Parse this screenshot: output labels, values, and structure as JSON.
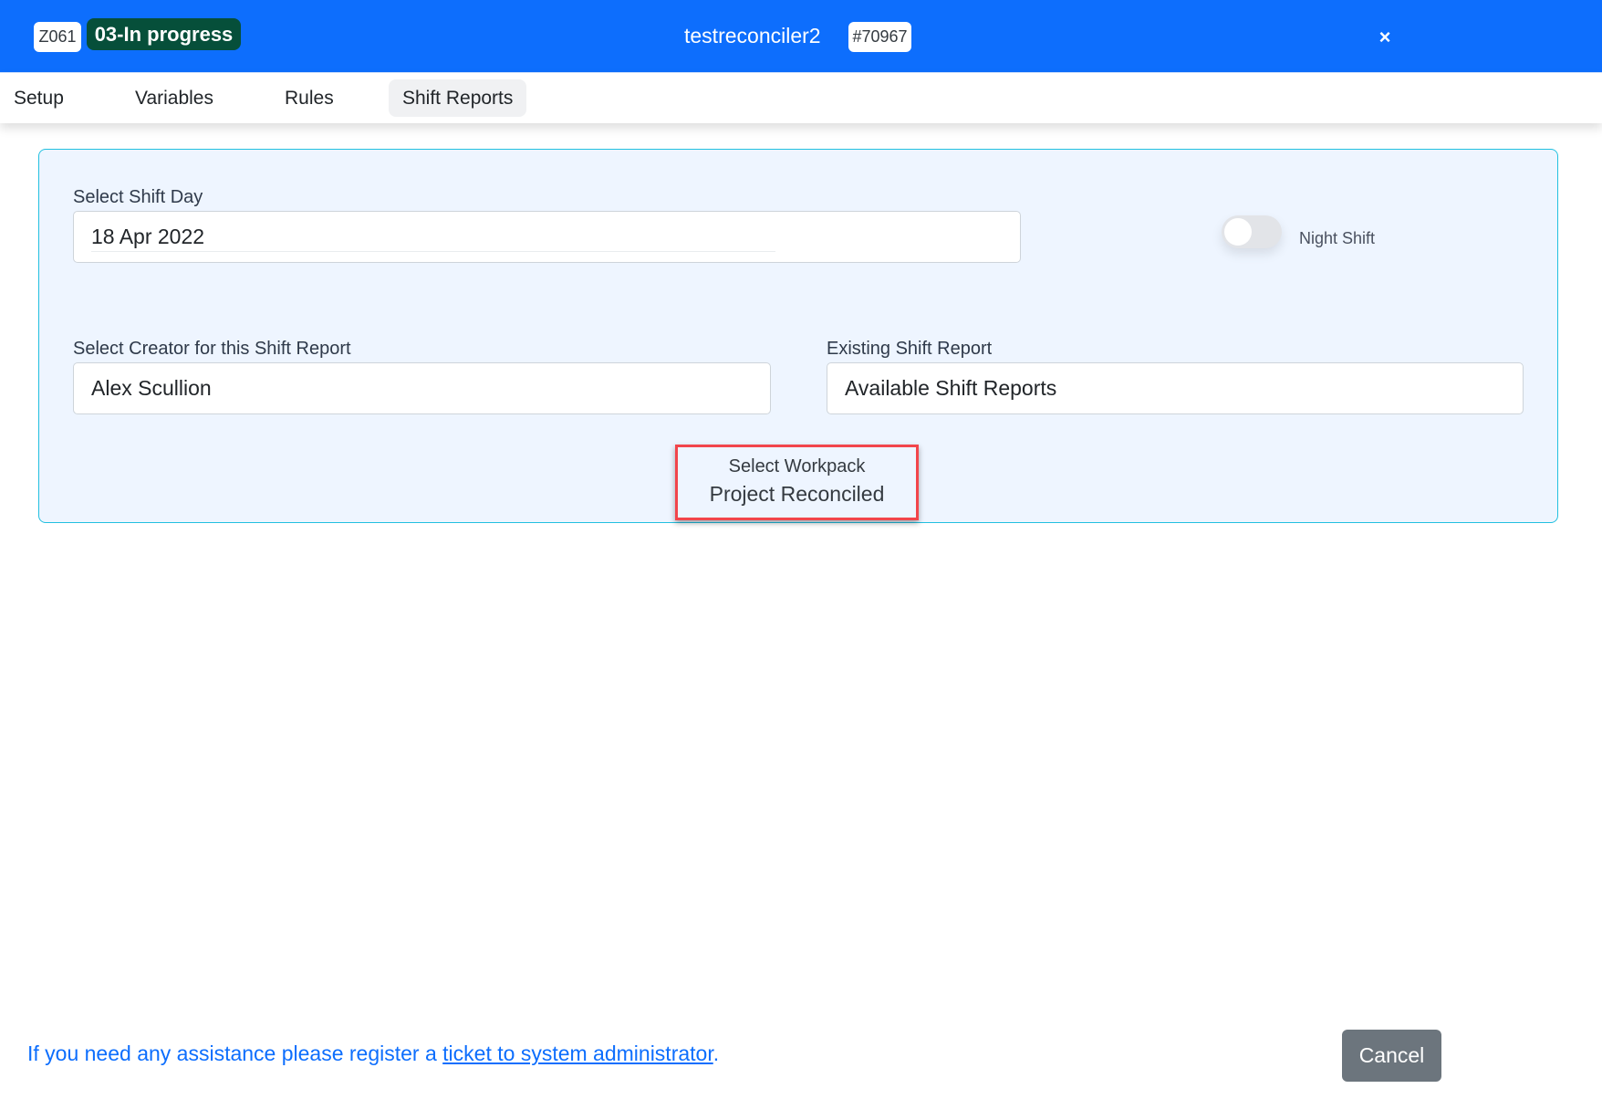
{
  "header": {
    "code_badge": "Z061",
    "status_badge": "03-In progress",
    "title": "testreconciler2",
    "id_badge": "#70967",
    "close_icon": "close-icon",
    "close_label": "×",
    "colors": {
      "header_bg": "#0d6efd",
      "status_bg": "#064f3a"
    }
  },
  "tabs": [
    {
      "label": "Setup",
      "active": false
    },
    {
      "label": "Variables",
      "active": false
    },
    {
      "label": "Rules",
      "active": false
    },
    {
      "label": "Shift Reports",
      "active": true
    }
  ],
  "form": {
    "shift_day": {
      "label": "Select Shift Day",
      "value": "18 Apr 2022"
    },
    "night_shift": {
      "label": "Night Shift",
      "checked": false
    },
    "creator": {
      "label": "Select Creator for this Shift Report",
      "value": "Alex Scullion"
    },
    "existing_report": {
      "label": "Existing Shift Report",
      "value": "Available Shift Reports"
    },
    "workpack": {
      "label": "Select Workpack",
      "value": "Project Reconciled"
    }
  },
  "footer": {
    "help_prefix": "If you need any assistance please register a ",
    "help_link": "ticket to system administrator",
    "help_suffix": ".",
    "cancel_label": "Cancel"
  }
}
